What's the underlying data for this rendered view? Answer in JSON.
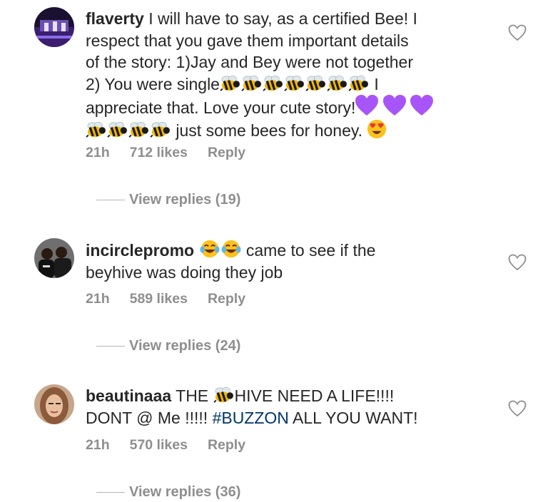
{
  "comments": [
    {
      "username": "flaverty",
      "text_lines": [
        "I will have to say, as a certified Bee! I",
        "respect that you gave them important details",
        "of the story: 1)Jay and Bey were not together",
        "2) You were single",
        "appreciate that. Love your cute story!",
        "just some bees for honey."
      ],
      "line4_tail": "I",
      "time": "21h",
      "likes": "712 likes",
      "reply_label": "Reply",
      "view_replies": "View replies (19)"
    },
    {
      "username": "incirclepromo",
      "text_lines": [
        "came to see if the",
        "beyhive was doing they job"
      ],
      "time": "21h",
      "likes": "589 likes",
      "reply_label": "Reply",
      "view_replies": "View replies (24)"
    },
    {
      "username": "beautinaaa",
      "text_pre": "THE",
      "text_post": "HIVE NEED A LIFE!!!!",
      "line2_pre": "DONT @ Me !!!!!",
      "hashtag": "#BUZZON",
      "line2_post": "ALL YOU WANT!",
      "time": "21h",
      "likes": "570 likes",
      "reply_label": "Reply",
      "view_replies": "View replies (36)"
    }
  ],
  "colors": {
    "text": "#262626",
    "meta": "#8e8e8e",
    "hashtag": "#00376b",
    "purple_heart": "#a855f7"
  },
  "icons": [
    "heart-icon",
    "bee-emoji",
    "purple-heart-emoji",
    "heart-eyes-emoji",
    "tears-of-joy-emoji"
  ]
}
